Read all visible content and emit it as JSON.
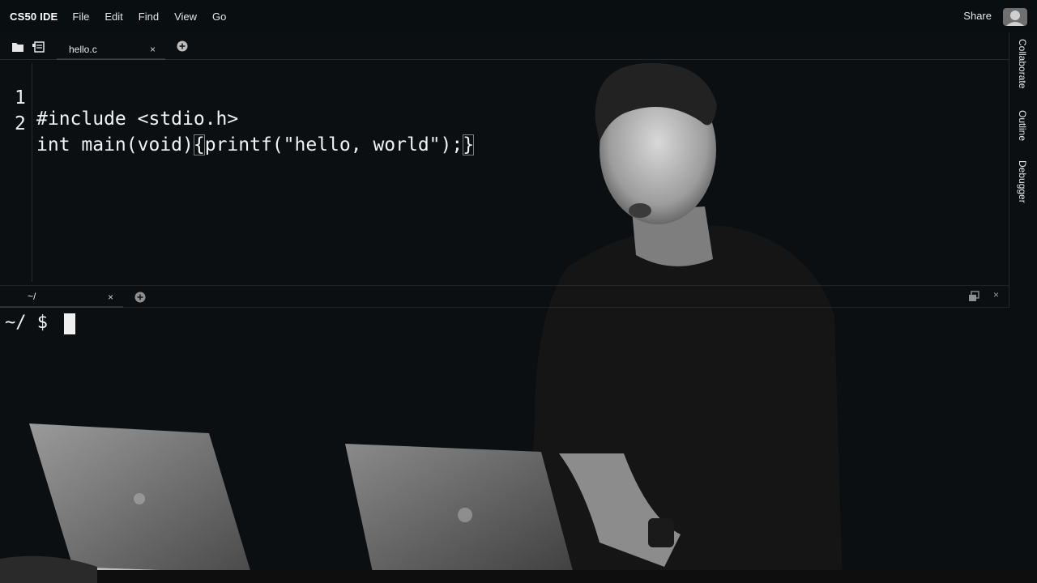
{
  "app": {
    "brand": "CS50 IDE",
    "menu": [
      "File",
      "Edit",
      "Find",
      "View",
      "Go"
    ],
    "share_label": "Share"
  },
  "tabs": {
    "file_tab_label": "hello.c",
    "file_tab_close": "×",
    "terminal_tab_label": "~/",
    "terminal_tab_close": "×",
    "terminal_close": "×"
  },
  "side_panel": [
    "Collaborate",
    "Outline",
    "Debugger"
  ],
  "editor": {
    "line_numbers": [
      "1",
      "2"
    ],
    "line1": "#include <stdio.h>",
    "line2_before": "int main(void)",
    "line2_open_brace": "{",
    "line2_body": "printf(\"hello, world\");",
    "line2_close_brace": "}"
  },
  "terminal": {
    "prompt": "~/ $"
  },
  "icons": {
    "folder": "folder-icon",
    "file": "file-icon",
    "add_tab": "plus-circle-icon",
    "restore": "restore-window-icon",
    "share_avatar": "avatar-icon"
  },
  "colors": {
    "background": "#0b0f12",
    "text": "#f2f2f2",
    "menu_text": "#e6e6e6"
  }
}
